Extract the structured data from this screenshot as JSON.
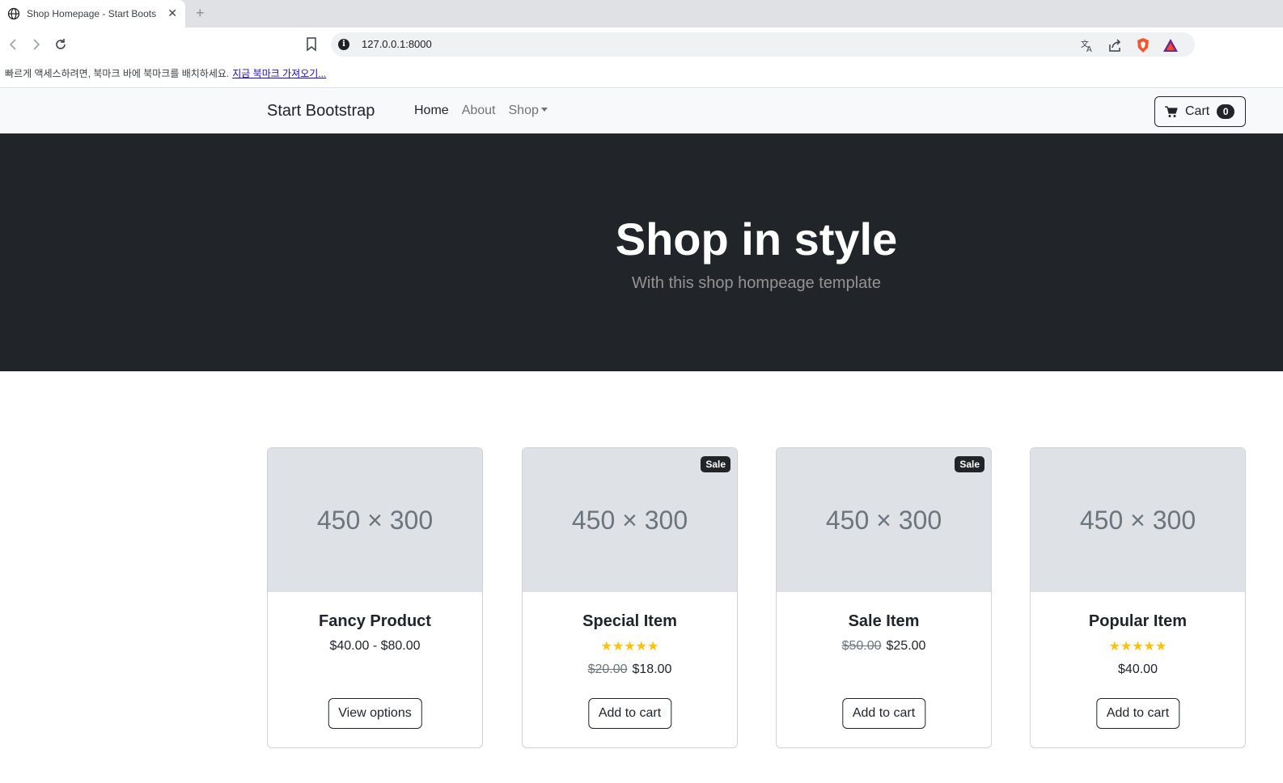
{
  "browser": {
    "tab_title": "Shop Homepage - Start Boots",
    "url": "127.0.0.1:8000",
    "bookmark_prompt": "빠르게 액세스하려면, 북마크 바에 북마크를 배치하세요.",
    "bookmark_import": "지금 북마크 가져오기..."
  },
  "navbar": {
    "brand": "Start Bootstrap",
    "links": [
      "Home",
      "About",
      "Shop"
    ],
    "cart_label": "Cart",
    "cart_count": "0"
  },
  "hero": {
    "title": "Shop in style",
    "subtitle": "With this shop hompeage template"
  },
  "products": [
    {
      "image": "450 × 300",
      "name": "Fancy Product",
      "price": "$40.00 - $80.00",
      "button": "View options"
    },
    {
      "image": "450 × 300",
      "badge": "Sale",
      "name": "Special Item",
      "rating": "★★★★★",
      "old_price": "$20.00",
      "price": "$18.00",
      "button": "Add to cart"
    },
    {
      "image": "450 × 300",
      "badge": "Sale",
      "name": "Sale Item",
      "old_price": "$50.00",
      "price": "$25.00",
      "button": "Add to cart"
    },
    {
      "image": "450 × 300",
      "name": "Popular Item",
      "rating": "★★★★★",
      "price": "$40.00",
      "button": "Add to cart"
    }
  ],
  "colors": {
    "hero_bg": "#212529",
    "navbar_bg": "#f8f9fa",
    "star": "#ffc107",
    "placeholder": "#dee2e6"
  }
}
